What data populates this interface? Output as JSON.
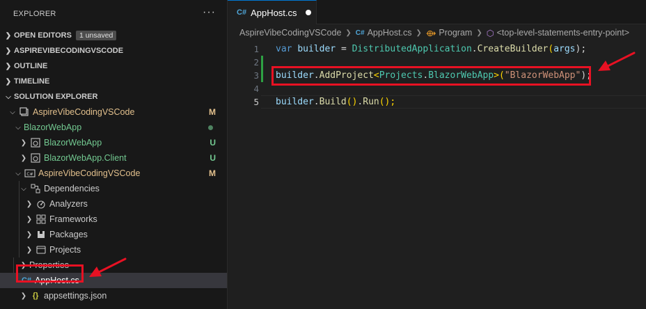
{
  "sidebar": {
    "title": "EXPLORER",
    "more": "···",
    "sections": [
      {
        "label": "OPEN EDITORS",
        "badge": "1 unsaved"
      },
      {
        "label": "ASPIREVIBECODINGVSCODE"
      },
      {
        "label": "OUTLINE"
      },
      {
        "label": "TIMELINE"
      },
      {
        "label": "SOLUTION EXPLORER"
      }
    ],
    "tree": [
      {
        "label": "AspireVibeCodingVSCode",
        "status": "M"
      },
      {
        "label": "BlazorWebApp"
      },
      {
        "label": "BlazorWebApp",
        "status": "U"
      },
      {
        "label": "BlazorWebApp.Client",
        "status": "U"
      },
      {
        "label": "AspireVibeCodingVSCode",
        "status": "M"
      },
      {
        "label": "Dependencies"
      },
      {
        "label": "Analyzers"
      },
      {
        "label": "Frameworks"
      },
      {
        "label": "Packages"
      },
      {
        "label": "Projects"
      },
      {
        "label": "Properties"
      },
      {
        "label": "AppHost.cs"
      },
      {
        "label": "appsettings.json"
      }
    ]
  },
  "editor": {
    "tab": {
      "label": "AppHost.cs",
      "icon": "C#"
    },
    "breadcrumbs": {
      "items": [
        "AspireVibeCodingVSCode",
        "AppHost.cs",
        "Program",
        "<top-level-statements-entry-point>"
      ]
    },
    "lines": [
      {
        "n": "1",
        "t": [
          "var",
          "builder",
          "=",
          "DistributedApplication",
          ".",
          "CreateBuilder",
          "(",
          "args",
          ");"
        ]
      },
      {
        "n": "2"
      },
      {
        "n": "3",
        "t": [
          "builder",
          ".",
          "AddProject",
          "<",
          "Projects",
          ".",
          "BlazorWebApp",
          ">",
          "(",
          "\"BlazorWebApp\"",
          ");"
        ]
      },
      {
        "n": "4"
      },
      {
        "n": "5",
        "t": [
          "builder",
          ".",
          "Build",
          "()",
          ".",
          "Run",
          "();"
        ]
      }
    ]
  },
  "colors": {
    "accent": "#0078d4",
    "annotation": "#e81123",
    "modified": "#e2c08d",
    "untracked": "#73c991"
  }
}
